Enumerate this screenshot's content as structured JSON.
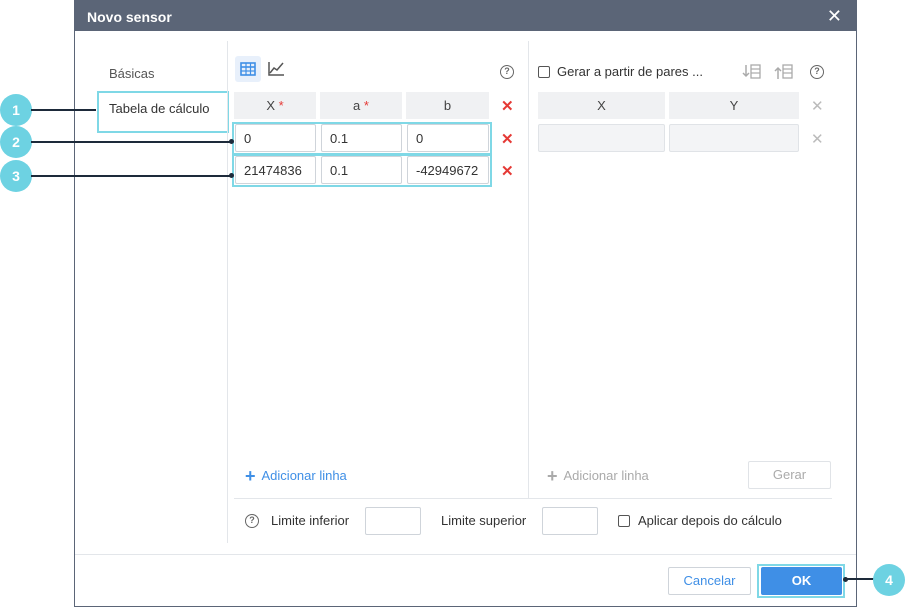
{
  "dialog": {
    "title": "Novo sensor",
    "close": "✕"
  },
  "nav": {
    "basic": "Básicas",
    "calc_table": "Tabela de cálculo"
  },
  "table": {
    "headers": [
      "X",
      "a",
      "b"
    ],
    "required_mark": "*",
    "rows": [
      [
        "0",
        "0.1",
        "0"
      ],
      [
        "21474836",
        "0.1",
        "-42949672"
      ]
    ],
    "delete": "✕",
    "add_line": "Adicionar linha"
  },
  "pairs": {
    "generate_label": "Gerar a partir de pares ...",
    "headers": [
      "X",
      "Y"
    ],
    "rows": [
      [
        "",
        ""
      ]
    ],
    "add_line": "Adicionar linha",
    "generate_button": "Gerar"
  },
  "limits": {
    "lower_label": "Limite inferior",
    "upper_label": "Limite superior",
    "lower_value": "",
    "upper_value": "",
    "apply_after": "Aplicar depois do cálculo"
  },
  "footer": {
    "cancel": "Cancelar",
    "ok": "OK"
  },
  "callouts": [
    "1",
    "2",
    "3",
    "4"
  ],
  "help_symbol": "?",
  "colors": {
    "titlebar": "#5b6577",
    "accent": "#3f8fe6",
    "highlight": "#7fd8e6",
    "danger": "#e53935",
    "callout": "#6dd2e2"
  }
}
